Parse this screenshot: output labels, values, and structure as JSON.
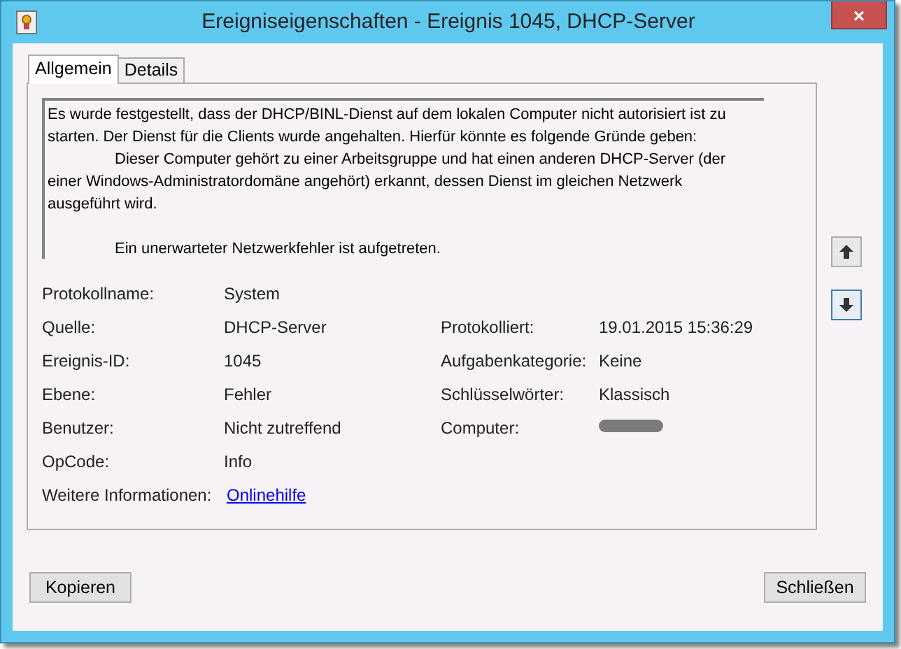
{
  "window": {
    "title": "Ereigniseigenschaften - Ereignis 1045, DHCP-Server",
    "close": "×"
  },
  "tabs": [
    {
      "label": "Allgemein",
      "selected": true
    },
    {
      "label": "Details",
      "selected": false
    }
  ],
  "message": [
    {
      "kind": "plain",
      "text": "Es wurde festgestellt, dass der DHCP/BINL-Dienst auf dem lokalen Computer nicht autorisiert ist zu starten. Der Dienst für die Clients wurde angehalten. Hierfür könnte es folgende Gründe geben:"
    },
    {
      "kind": "indented",
      "text": "Dieser Computer gehört zu einer Arbeitsgruppe und hat einen anderen DHCP-Server (der einer Windows-Administratordomäne angehört) erkannt, dessen Dienst im gleichen Netzwerk ausgeführt wird."
    },
    {
      "kind": "gap"
    },
    {
      "kind": "indented",
      "text": "Ein unerwarteter Netzwerkfehler ist aufgetreten."
    }
  ],
  "left_fields": [
    {
      "kind": "text",
      "label": "Protokollname:",
      "value": "System"
    },
    {
      "kind": "text",
      "label": "Quelle:",
      "value": "DHCP-Server"
    },
    {
      "kind": "text",
      "label": "Ereignis-ID:",
      "value": "1045"
    },
    {
      "kind": "text",
      "label": "Ebene:",
      "value": "Fehler"
    },
    {
      "kind": "text",
      "label": "Benutzer:",
      "value": "Nicht zutreffend"
    },
    {
      "kind": "text",
      "label": "OpCode:",
      "value": "Info"
    },
    {
      "kind": "link",
      "label": "Weitere Informationen:",
      "value": "Onlinehilfe"
    }
  ],
  "right_fields": [
    {
      "kind": "text",
      "label": "Protokolliert:",
      "value": "19.01.2015 15:36:29"
    },
    {
      "kind": "text",
      "label": "Aufgabenkategorie:",
      "value": "Keine"
    },
    {
      "kind": "text",
      "label": "Schlüsselwörter:",
      "value": "Klassisch"
    },
    {
      "kind": "redacted",
      "label": "Computer:"
    }
  ],
  "buttons": [
    "Kopieren",
    "Schließen"
  ]
}
